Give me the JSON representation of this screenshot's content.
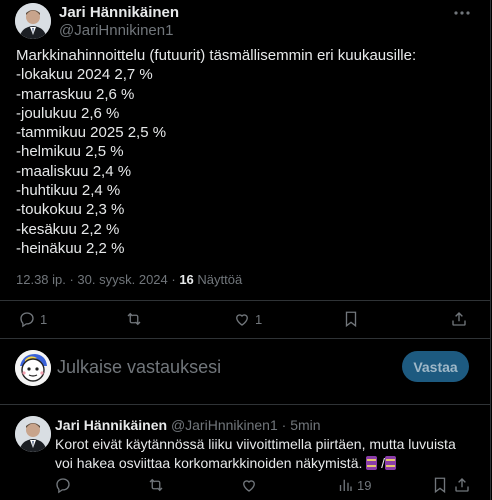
{
  "tweet": {
    "author_name": "Jari Hännikäinen",
    "author_handle": "@JariHnnikinen1",
    "lines": [
      "Markkinahinnoittelu (futuurit) täsmällisemmin eri kuukausille:",
      "-lokakuu 2024 2,7 %",
      "-marraskuu 2,6 %",
      "-joulukuu 2,6 %",
      "-tammikuu 2025 2,5 %",
      "-helmikuu 2,5 %",
      "-maaliskuu 2,4 %",
      "-huhtikuu 2,4 %",
      "-toukokuu 2,3 %",
      "-kesäkuu 2,2 %",
      "-heinäkuu 2,2 %"
    ],
    "timestamp": "12.38 ip. · 30. syysk. 2024 ·",
    "views_count": "16",
    "views_label": "Näyttöä",
    "actions": {
      "reply_count": "1",
      "retweet_count": "",
      "like_count": "1"
    },
    "icons": [
      "more-icon",
      "reply-icon",
      "retweet-icon",
      "like-icon",
      "bookmark-icon",
      "share-icon"
    ]
  },
  "composer": {
    "placeholder": "Julkaise vastauksesi",
    "button_label": "Vastaa"
  },
  "reply": {
    "author_name": "Jari Hännikäinen",
    "author_handle": "@JariHnnikinen1",
    "time": "· 5min",
    "text": "Korot eivät käytännössä liiku viivoittimella piirtäen, mutta luvuista voi hakea osviittaa korkomarkkinoiden näkymistä.",
    "text_suffix": "/",
    "views_count": "19",
    "icons": [
      "reply-icon",
      "retweet-icon",
      "like-icon",
      "views-icon",
      "bookmark-icon",
      "share-icon"
    ]
  },
  "colors": {
    "background": "#000000",
    "text": "#e7e9ea",
    "muted": "#71767b",
    "border": "#2f3336",
    "button": "#1d5a80"
  }
}
